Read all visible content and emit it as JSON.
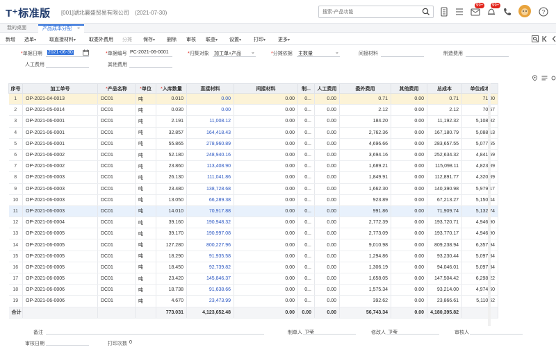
{
  "header": {
    "logo": "T⁺标准版",
    "company": "[001]湖北襄盛贸易有限公司",
    "date": "(2021-07-30)",
    "search_placeholder": "搜索-产品功能",
    "badge_messages": "99+",
    "badge_notices": "99+"
  },
  "tabs": [
    {
      "label": "我的桌面"
    },
    {
      "label": "产品成本分配",
      "close": "×"
    }
  ],
  "toolbar": {
    "new": "新增",
    "select": "选单",
    "fetch_material": "取直接材料",
    "fetch_outsource": "取委外费用",
    "allocate": "分摊",
    "save": "保存",
    "delete": "删除",
    "audit": "审核",
    "linked": "联查",
    "settings": "设置",
    "print": "打印",
    "more": "更多"
  },
  "form": {
    "doc_date_label": "单据日期",
    "doc_date_value": "2021-06-30",
    "doc_no_label": "单据编号",
    "doc_no_value": "PC-2021-06-0001",
    "collect_label": "归集对象",
    "collect_value": "加工单+产品",
    "basis_label": "分摊依据",
    "basis_value": "主数量",
    "indirect_label": "间接材料",
    "manufacture_label": "制造费用",
    "labor_label": "人工费用",
    "other_label": "其他费用"
  },
  "table": {
    "headers": {
      "idx": "序号",
      "order": "加工单号",
      "product": "产品名称",
      "unit": "单位",
      "qty": "入库数量",
      "direct": "直接材料",
      "indirect": "间接材料",
      "mfg": "制...",
      "labor": "人工费用",
      "outsource": "委外费用",
      "other": "其他费用",
      "total": "总成本",
      "unitcost": "单位成本"
    },
    "rows": [
      {
        "idx": "1",
        "order": "OP-2021-04-0013",
        "product": "DC01",
        "unit": "吨",
        "qty": "0.010",
        "direct": "0.00",
        "indirect": "0.00",
        "mfg": "0...",
        "labor": "0.00",
        "outsource": "0.71",
        "other": "0.00",
        "total": "0.71",
        "unitcost": "71.00"
      },
      {
        "idx": "2",
        "order": "OP-2021-05-0014",
        "product": "DC01",
        "unit": "吨",
        "qty": "0.030",
        "direct": "0.00",
        "indirect": "0.00",
        "mfg": "0...",
        "labor": "0.00",
        "outsource": "2.12",
        "other": "0.00",
        "total": "2.12",
        "unitcost": "70.67"
      },
      {
        "idx": "3",
        "order": "OP-2021-06-0001",
        "product": "DC01",
        "unit": "吨",
        "qty": "2.191",
        "direct": "11,008.12",
        "indirect": "0.00",
        "mfg": "0...",
        "labor": "0.00",
        "outsource": "184.20",
        "other": "0.00",
        "total": "11,192.32",
        "unitcost": "5,108.32"
      },
      {
        "idx": "4",
        "order": "OP-2021-06-0001",
        "product": "DC01",
        "unit": "吨",
        "qty": "32.857",
        "direct": "164,418.43",
        "indirect": "0.00",
        "mfg": "0...",
        "labor": "0.00",
        "outsource": "2,762.36",
        "other": "0.00",
        "total": "167,180.79",
        "unitcost": "5,088.13"
      },
      {
        "idx": "5",
        "order": "OP-2021-06-0001",
        "product": "DC01",
        "unit": "吨",
        "qty": "55.865",
        "direct": "278,960.89",
        "indirect": "0.00",
        "mfg": "0...",
        "labor": "0.00",
        "outsource": "4,696.66",
        "other": "0.00",
        "total": "283,657.55",
        "unitcost": "5,077.55"
      },
      {
        "idx": "6",
        "order": "OP-2021-06-0002",
        "product": "DC01",
        "unit": "吨",
        "qty": "52.180",
        "direct": "248,940.16",
        "indirect": "0.00",
        "mfg": "0...",
        "labor": "0.00",
        "outsource": "3,694.16",
        "other": "0.00",
        "total": "252,634.32",
        "unitcost": "4,841.59"
      },
      {
        "idx": "7",
        "order": "OP-2021-06-0002",
        "product": "DC01",
        "unit": "吨",
        "qty": "23.860",
        "direct": "113,408.90",
        "indirect": "0.00",
        "mfg": "0...",
        "labor": "0.00",
        "outsource": "1,689.21",
        "other": "0.00",
        "total": "115,098.11",
        "unitcost": "4,823.89"
      },
      {
        "idx": "8",
        "order": "OP-2021-06-0003",
        "product": "DC01",
        "unit": "吨",
        "qty": "26.130",
        "direct": "111,041.86",
        "indirect": "0.00",
        "mfg": "0...",
        "labor": "0.00",
        "outsource": "1,849.91",
        "other": "0.00",
        "total": "112,891.77",
        "unitcost": "4,320.39"
      },
      {
        "idx": "9",
        "order": "OP-2021-06-0003",
        "product": "DC01",
        "unit": "吨",
        "qty": "23.480",
        "direct": "138,728.68",
        "indirect": "0.00",
        "mfg": "0...",
        "labor": "0.00",
        "outsource": "1,662.30",
        "other": "0.00",
        "total": "140,390.98",
        "unitcost": "5,979.17"
      },
      {
        "idx": "10",
        "order": "OP-2021-06-0003",
        "product": "DC01",
        "unit": "吨",
        "qty": "13.050",
        "direct": "66,289.38",
        "indirect": "0.00",
        "mfg": "0...",
        "labor": "0.00",
        "outsource": "923.89",
        "other": "0.00",
        "total": "67,213.27",
        "unitcost": "5,150.44"
      },
      {
        "idx": "11",
        "order": "OP-2021-06-0003",
        "product": "DC01",
        "unit": "吨",
        "qty": "14.010",
        "direct": "70,917.88",
        "indirect": "0.00",
        "mfg": "0...",
        "labor": "0.00",
        "outsource": "991.86",
        "other": "0.00",
        "total": "71,909.74",
        "unitcost": "5,132.74"
      },
      {
        "idx": "12",
        "order": "OP-2021-06-0004",
        "product": "DC01",
        "unit": "吨",
        "qty": "39.160",
        "direct": "190,948.32",
        "indirect": "0.00",
        "mfg": "0...",
        "labor": "0.00",
        "outsource": "2,772.39",
        "other": "0.00",
        "total": "193,720.71",
        "unitcost": "4,946.90"
      },
      {
        "idx": "13",
        "order": "OP-2021-06-0005",
        "product": "DC01",
        "unit": "吨",
        "qty": "39.170",
        "direct": "190,997.08",
        "indirect": "0.00",
        "mfg": "0...",
        "labor": "0.00",
        "outsource": "2,773.09",
        "other": "0.00",
        "total": "193,770.17",
        "unitcost": "4,946.90"
      },
      {
        "idx": "14",
        "order": "OP-2021-06-0005",
        "product": "DC01",
        "unit": "吨",
        "qty": "127.280",
        "direct": "800,227.96",
        "indirect": "0.00",
        "mfg": "0...",
        "labor": "0.00",
        "outsource": "9,010.98",
        "other": "0.00",
        "total": "809,238.94",
        "unitcost": "6,357.94"
      },
      {
        "idx": "15",
        "order": "OP-2021-06-0005",
        "product": "DC01",
        "unit": "吨",
        "qty": "18.290",
        "direct": "91,935.58",
        "indirect": "0.00",
        "mfg": "0...",
        "labor": "0.00",
        "outsource": "1,294.86",
        "other": "0.00",
        "total": "93,230.44",
        "unitcost": "5,097.34"
      },
      {
        "idx": "16",
        "order": "OP-2021-06-0005",
        "product": "DC01",
        "unit": "吨",
        "qty": "18.450",
        "direct": "92,739.82",
        "indirect": "0.00",
        "mfg": "0...",
        "labor": "0.00",
        "outsource": "1,306.19",
        "other": "0.00",
        "total": "94,046.01",
        "unitcost": "5,097.34"
      },
      {
        "idx": "17",
        "order": "OP-2021-06-0005",
        "product": "DC01",
        "unit": "吨",
        "qty": "23.420",
        "direct": "145,846.37",
        "indirect": "0.00",
        "mfg": "0...",
        "labor": "0.00",
        "outsource": "1,658.05",
        "other": "0.00",
        "total": "147,504.42",
        "unitcost": "6,298.22"
      },
      {
        "idx": "18",
        "order": "OP-2021-06-0006",
        "product": "DC01",
        "unit": "吨",
        "qty": "18.738",
        "direct": "91,638.66",
        "indirect": "0.00",
        "mfg": "0...",
        "labor": "0.00",
        "outsource": "1,575.34",
        "other": "0.00",
        "total": "93,214.00",
        "unitcost": "4,974.60"
      },
      {
        "idx": "19",
        "order": "OP-2021-06-0006",
        "product": "DC01",
        "unit": "吨",
        "qty": "4.670",
        "direct": "23,473.99",
        "indirect": "0.00",
        "mfg": "0...",
        "labor": "0.00",
        "outsource": "392.62",
        "other": "0.00",
        "total": "23,866.61",
        "unitcost": "5,110.62"
      }
    ],
    "total": {
      "label": "合计",
      "qty": "773.031",
      "direct": "4,123,652.48",
      "indirect": "0.00",
      "mfg": "0.00",
      "labor": "0.00",
      "outsource": "56,743.34",
      "other": "0.00",
      "total": "4,180,395.82"
    }
  },
  "footer": {
    "remark_label": "备注",
    "creator_label": "制单人",
    "creator_value": "卫莹",
    "modifier_label": "修改人",
    "modifier_value": "卫莹",
    "auditor_label": "审核人",
    "audit_date_label": "审核日期",
    "print_count_label": "打印次数",
    "print_count_value": "0"
  },
  "colors": {
    "brand": "#1f3a6b",
    "accent": "#2b6dd9",
    "badge": "#e2231a",
    "selected_row": "#fcf3d7",
    "hover_row": "#e8f1fc"
  }
}
